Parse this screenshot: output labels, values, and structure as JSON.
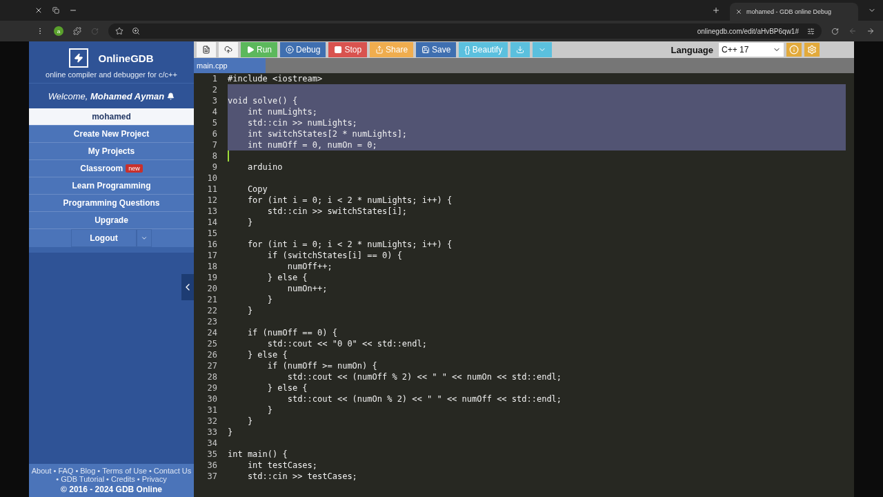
{
  "browser": {
    "tab_title": "mohamed - GDB online Debug",
    "url": "onlinegdb.com/edit/aHvBP6qw1#",
    "profile": "a"
  },
  "sidebar": {
    "brand": "OnlineGDB",
    "tagline": "online compiler and debugger for c/c++",
    "welcome": "Welcome, **Mohamed Ayman**",
    "items": [
      {
        "label": "mohamed",
        "selected": true
      },
      {
        "label": "Create New Project",
        "selected": false
      },
      {
        "label": "My Projects",
        "selected": false
      },
      {
        "label": "Classroom",
        "selected": false,
        "badge": "new"
      },
      {
        "label": "Learn Programming",
        "selected": false
      },
      {
        "label": "Programming Questions",
        "selected": false
      },
      {
        "label": "Upgrade",
        "selected": false
      }
    ],
    "logout": "Logout",
    "footer_links": [
      {
        "label": "About"
      },
      {
        "label": "FAQ"
      },
      {
        "label": "Blog"
      },
      {
        "label": "Terms of Use"
      },
      {
        "label": "Contact Us"
      },
      {
        "label": "GDB Tutorial"
      },
      {
        "label": "Credits"
      },
      {
        "label": "Privacy"
      }
    ],
    "separator": "•",
    "copyright": "© 2016 - 2024 GDB Online"
  },
  "toolbar": {
    "buttons": [
      {
        "kind": "new-file"
      },
      {
        "kind": "upload"
      },
      {
        "kind": "run",
        "label": "Run"
      },
      {
        "kind": "debug",
        "label": "Debug"
      },
      {
        "kind": "stop",
        "label": "Stop"
      },
      {
        "kind": "share",
        "label": "Share"
      },
      {
        "kind": "save",
        "label": "Save"
      },
      {
        "kind": "beautify",
        "label": "{} Beautify"
      },
      {
        "kind": "download"
      }
    ],
    "language_label": "Language",
    "language": "C++ 17"
  },
  "file_tabs": [
    {
      "label": "main.cpp",
      "selected": true
    }
  ],
  "code": {
    "lines": [
      {
        "number": "1",
        "text": "#include <iostream>",
        "selected": false
      },
      {
        "number": "2",
        "selected": true
      },
      {
        "number": "3",
        "text": "void solve() {",
        "selected": true
      },
      {
        "number": "4",
        "text": "    int numLights;",
        "selected": true
      },
      {
        "number": "5",
        "text": "    std::cin >> numLights;",
        "selected": true
      },
      {
        "number": "6",
        "text": "    int switchStates[2 * numLights];",
        "selected": true
      },
      {
        "number": "7",
        "text": "    int numOff = 0, numOn = 0;",
        "selected": true
      },
      {
        "number": "8",
        "cursor": true
      },
      {
        "number": "9",
        "text": "    arduino",
        "selected": false
      },
      {
        "number": "10"
      },
      {
        "number": "11",
        "text": "    Copy",
        "selected": false
      },
      {
        "number": "12",
        "text": "    for (int i = 0; i < 2 * numLights; i++) {",
        "selected": false
      },
      {
        "number": "13",
        "text": "        std::cin >> switchStates[i];",
        "selected": false
      },
      {
        "number": "14",
        "text": "    }",
        "selected": false
      },
      {
        "number": "15"
      },
      {
        "number": "16",
        "text": "    for (int i = 0; i < 2 * numLights; i++) {",
        "selected": false
      },
      {
        "number": "17",
        "text": "        if (switchStates[i] == 0) {",
        "selected": false
      },
      {
        "number": "18",
        "text": "            numOff++;",
        "selected": false
      },
      {
        "number": "19",
        "text": "        } else {",
        "selected": false
      },
      {
        "number": "20",
        "text": "            numOn++;",
        "selected": false
      },
      {
        "number": "21",
        "text": "        }",
        "selected": false
      },
      {
        "number": "22",
        "text": "    }",
        "selected": false
      },
      {
        "number": "23"
      },
      {
        "number": "24",
        "text": "    if (numOff == 0) {",
        "selected": false
      },
      {
        "number": "25",
        "text": "        std::cout << \"0 0\" << std::endl;",
        "selected": false
      },
      {
        "number": "26",
        "text": "    } else {",
        "selected": false
      },
      {
        "number": "27",
        "text": "        if (numOff >= numOn) {",
        "selected": false
      },
      {
        "number": "28",
        "text": "            std::cout << (numOff % 2) << \" \" << numOn << std::endl;",
        "selected": false
      },
      {
        "number": "29",
        "text": "        } else {",
        "selected": false
      },
      {
        "number": "30",
        "text": "            std::cout << (numOn % 2) << \" \" << numOff << std::endl;",
        "selected": false
      },
      {
        "number": "31",
        "text": "        }",
        "selected": false
      },
      {
        "number": "32",
        "text": "    }",
        "selected": false
      },
      {
        "number": "33",
        "text": "}",
        "selected": false
      },
      {
        "number": "34"
      },
      {
        "number": "35",
        "text": "int main() {",
        "selected": false
      },
      {
        "number": "36",
        "text": "    int testCases;",
        "selected": false
      },
      {
        "number": "37",
        "text": "    std::cin >> testCases;",
        "selected": false
      }
    ]
  }
}
